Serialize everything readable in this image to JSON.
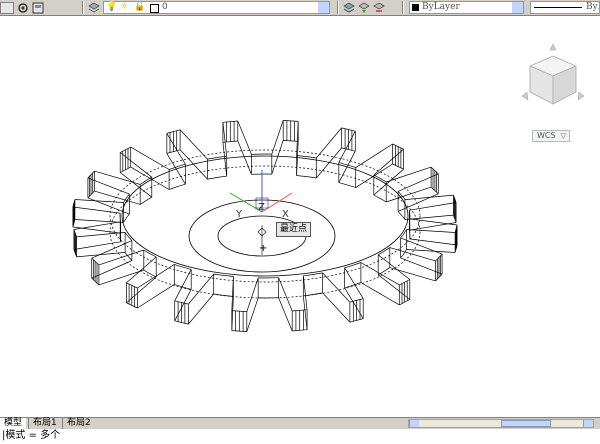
{
  "toolbar": {
    "layer_value": "0",
    "color_value": "ByLayer",
    "lineweight_value": "ByL"
  },
  "viewcube": {
    "ucs_label": "WCS"
  },
  "ucs_icon": {
    "x_label": "X",
    "y_label": "Y",
    "z_label": "Z"
  },
  "tooltip": {
    "osnap_label": "最近点"
  },
  "tabs": {
    "model": "模型",
    "layout1": "布局1",
    "layout2": "布局2"
  },
  "command": {
    "prompt": "|模式 = 多个"
  },
  "colors": {
    "toolbar_bg": "#d4d0c8",
    "drawing_line": "#000000",
    "ucs_x": "#ff4444",
    "ucs_y": "#22aa22",
    "ucs_z": "#3355ff"
  }
}
